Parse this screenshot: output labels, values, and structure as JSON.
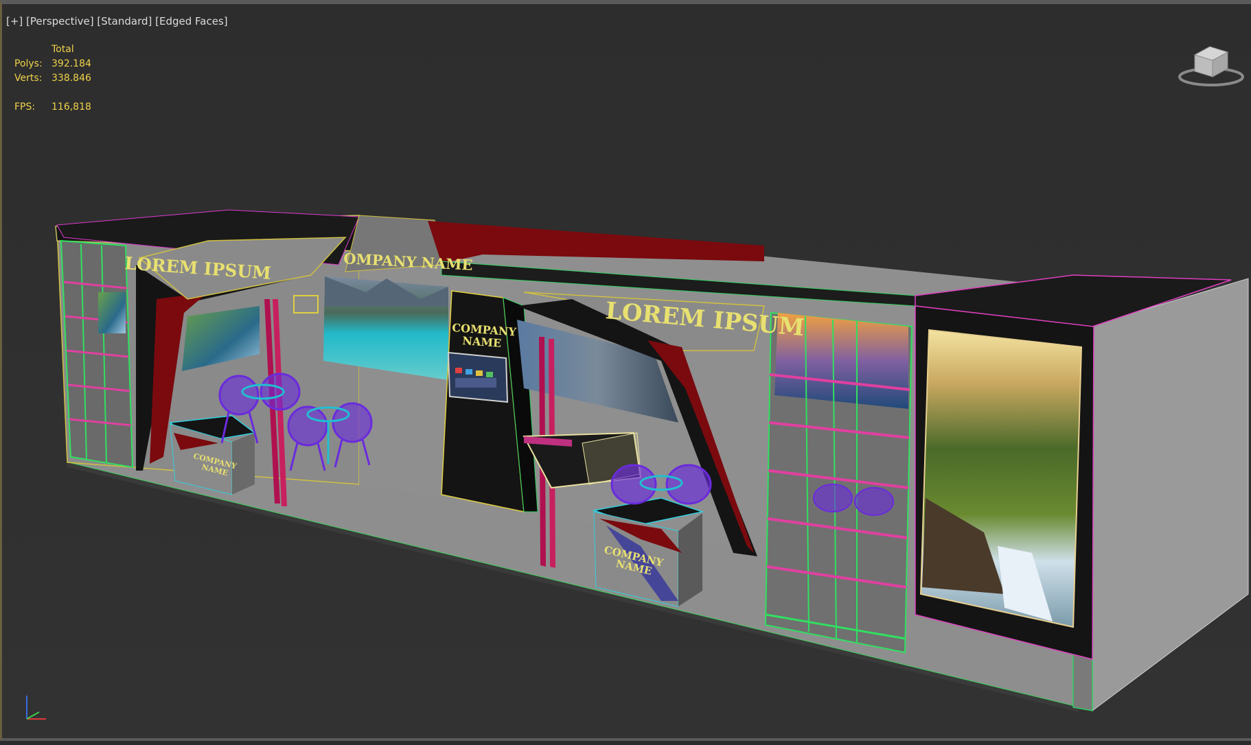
{
  "viewport": {
    "menu_plus": "[+]",
    "menu_view": "[Perspective]",
    "menu_shading": "[Standard]",
    "menu_edges": "[Edged Faces]"
  },
  "stats": {
    "total_label": "Total",
    "polys_label": "Polys:",
    "polys_value": "392.184",
    "verts_label": "Verts:",
    "verts_value": "338.846",
    "fps_label": "FPS:",
    "fps_value": "116,818"
  },
  "scene": {
    "sign_lorem_left": "LOREM IPSUM",
    "sign_company_top": "OMPANY NAME",
    "sign_lorem_right": "LOREM IPSUM",
    "pillar_company_line1": "COMPANY",
    "pillar_company_line2": "NAME",
    "counter_left_line1": "COMPANY",
    "counter_left_line2": "NAME",
    "counter_mid_line1": "COMPANY",
    "counter_mid_line2": "NAME"
  },
  "colors": {
    "background": "#2d2d2d",
    "stats_text": "#f0d24a",
    "sign_text": "#e8e070",
    "booth_wall": "#8f8f8f",
    "booth_dark": "#141414",
    "accent_red": "#7a0a0e",
    "pillar_magenta": "#b0104f",
    "chair_purple": "#6a2bdc",
    "wire_green": "#2fe05a",
    "wire_magenta": "#e040c0"
  },
  "icons": {
    "viewcube": "viewcube-icon",
    "axis": "axis-tripod-icon"
  }
}
